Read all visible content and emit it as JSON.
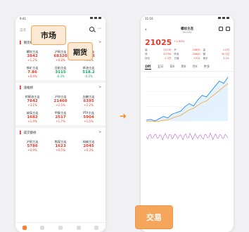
{
  "left_phone": {
    "status_time": "9:41",
    "top_tabs": [
      "自选",
      "市场",
      "期货"
    ],
    "sections": [
      {
        "title": "期货概览",
        "action": ">",
        "items": [
          {
            "name": "螺纹主连",
            "price": "3842",
            "change": "+1.2%",
            "dir": "up"
          },
          {
            "name": "沪铜主连",
            "price": "68320",
            "change": "+0.8%",
            "dir": "up"
          },
          {
            "name": "黄金主连",
            "price": "452.3",
            "change": "+0.6%",
            "dir": "up"
          },
          {
            "name": "铁矿主连",
            "price": "7.86",
            "change": "+0.4%",
            "dir": "up"
          },
          {
            "name": "豆粕主连",
            "price": "3115",
            "change": "-0.3%",
            "dir": "dn"
          },
          {
            "name": "原油主连",
            "price": "518.2",
            "change": "-0.2%",
            "dir": "dn"
          }
        ]
      },
      {
        "title": "涨幅榜",
        "action": ">",
        "items": [
          {
            "name": "棕榈油主连",
            "price": "7842",
            "change": "+3.1%",
            "dir": "up"
          },
          {
            "name": "沪锌主连",
            "price": "21460",
            "change": "+2.5%",
            "dir": "up"
          },
          {
            "name": "白糖主连",
            "price": "6395",
            "change": "+2.2%",
            "dir": "up"
          },
          {
            "name": "玻璃主连",
            "price": "1682",
            "change": "+1.9%",
            "dir": "up"
          },
          {
            "name": "甲醇主连",
            "price": "2517",
            "change": "+1.7%",
            "dir": "up"
          },
          {
            "name": "PTA主连",
            "price": "5904",
            "change": "+1.5%",
            "dir": "up"
          }
        ]
      },
      {
        "title": "成交额榜",
        "action": ">",
        "items": [
          {
            "name": "沪银主连",
            "price": "5786",
            "change": "+0.9%",
            "dir": "up"
          },
          {
            "name": "焦煤主连",
            "price": "1623",
            "change": "+0.5%",
            "dir": "up"
          },
          {
            "name": "纯碱主连",
            "price": "2045",
            "change": "+0.3%",
            "dir": "up"
          }
        ]
      }
    ]
  },
  "callouts": {
    "market": "市场",
    "futures": "期货",
    "trade": "交易"
  },
  "right_phone": {
    "status_time": "11:10",
    "title": "螺纹主连",
    "subtitle": "rb2405",
    "price": "21025",
    "price_sub": "+1.85%",
    "stats": [
      {
        "k": "高",
        "v": "21130"
      },
      {
        "k": "开",
        "v": "20850"
      },
      {
        "k": "量",
        "v": "1.4万"
      },
      {
        "k": "低",
        "v": "20790"
      },
      {
        "k": "昨收",
        "v": "20640"
      },
      {
        "k": "额",
        "v": "30.1亿"
      },
      {
        "k": "持仓",
        "v": "2.3万"
      },
      {
        "k": "日增",
        "v": "+512"
      },
      {
        "k": "换手",
        "v": "3.1%"
      }
    ],
    "tabs": [
      "分时",
      "五日",
      "日K",
      "周K",
      "月K",
      "更多"
    ]
  },
  "chart_data": {
    "type": "line",
    "series": [
      {
        "values": [
          1.0,
          1.01,
          0.99,
          1.02,
          1.05,
          1.03,
          1.08,
          1.1,
          1.12,
          1.18,
          1.22,
          1.19,
          1.27,
          1.33,
          1.31,
          1.38,
          1.45,
          1.52,
          1.49,
          1.57
        ]
      }
    ],
    "colors": {
      "line": "#2d8cf0",
      "ma": "#f5a623"
    }
  }
}
